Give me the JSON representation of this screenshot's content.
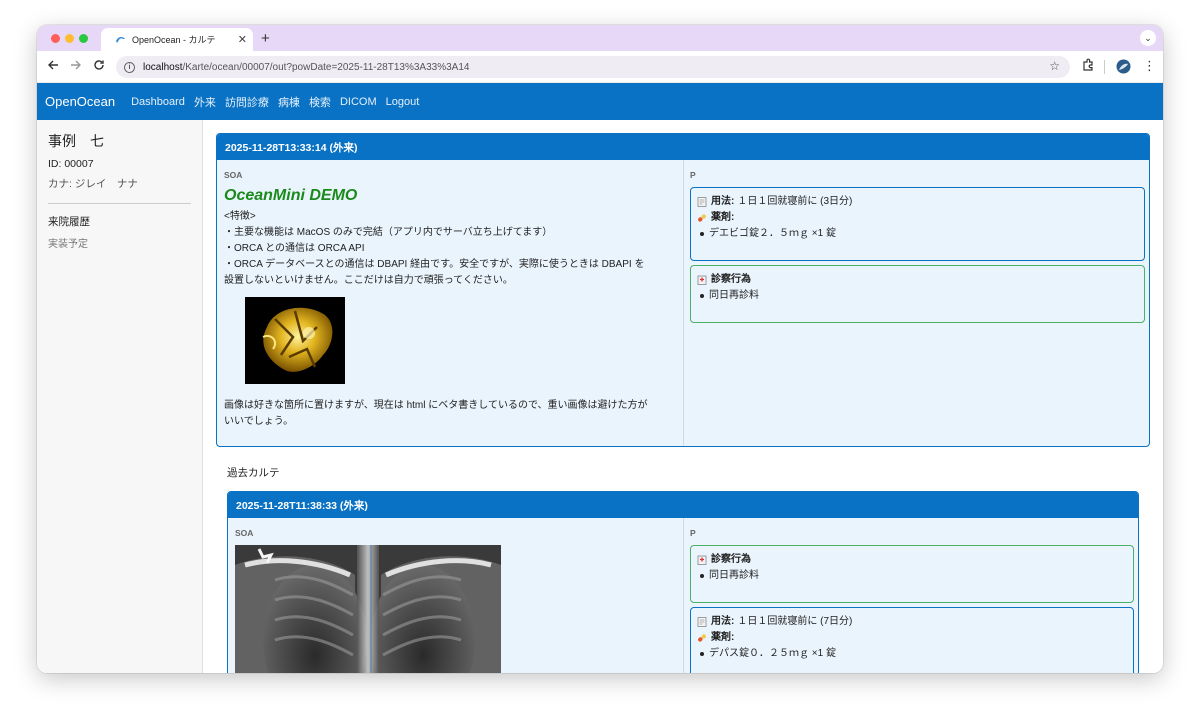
{
  "browser": {
    "tab_title": "OpenOcean - カルテ",
    "new_tab": "+",
    "url_host": "localhost",
    "url_path": "/Karte/ocean/00007/out?powDate=2025-11-28T13%3A33%3A14"
  },
  "nav": {
    "brand": "OpenOcean",
    "links": [
      "Dashboard",
      "外来",
      "訪問診療",
      "病棟",
      "検索",
      "DICOM",
      "Logout"
    ]
  },
  "sidebar": {
    "patient_name": "事例　七",
    "id_line": "ID: 00007",
    "kana_line": "カナ: ジレイ　ナナ",
    "history_heading": "来院履歴",
    "history_status": "実装予定"
  },
  "current_record": {
    "header": "2025-11-28T13:33:14 (外来)",
    "soa_label": "SOA",
    "p_label": "P",
    "demo_title": "OceanMini DEMO",
    "features": [
      "<特徴>",
      "・主要な機能は MacOS のみで完結（アプリ内でサーバ立ち上げてます）",
      "・ORCA との通信は ORCA API",
      "・ORCA データベースとの通信は DBAPI 経由です。安全ですが、実際に使うときは DBAPI を",
      "設置しないといけません。ここだけは自力で頑張ってください。"
    ],
    "image_note_1": "画像は好きな箇所に置けますが、現在は html にベタ書きしているので、重い画像は避けた方が",
    "image_note_2": "いいでしょう。",
    "rx": {
      "usage_label": "用法:",
      "usage_value": "１日１回就寝前に (3日分)",
      "drug_label": "薬剤:",
      "drug_item": "デエビゴ錠２．５ｍｇ ×1 錠"
    },
    "procedure": {
      "label": "診察行為",
      "item": "同日再診料"
    }
  },
  "past_label": "過去カルテ",
  "past_record": {
    "header": "2025-11-28T11:38:33 (外来)",
    "soa_label": "SOA",
    "p_label": "P",
    "procedure": {
      "label": "診察行為",
      "item": "同日再診料"
    },
    "rx": {
      "usage_label": "用法:",
      "usage_value": "１日１回就寝前に (7日分)",
      "drug_label": "薬剤:",
      "drug_item": "デパス錠０．２５ｍｇ ×1 錠"
    }
  },
  "colors": {
    "brand_blue": "#0a72c4",
    "card_bg": "#eaf4fd",
    "demo_green": "#1a8a1a",
    "procedure_border": "#49b066",
    "tabbar": "#e7d8f7"
  },
  "icons": {
    "back": "arrow-left-icon",
    "forward": "arrow-right-icon",
    "reload": "reload-icon",
    "info": "site-info-icon",
    "bookmark": "star-icon",
    "extensions": "puzzle-icon",
    "profile": "avatar",
    "menu": "kebab-menu-icon",
    "usage": "memo-icon",
    "drug": "pill-icon",
    "procedure": "hospital-icon"
  }
}
